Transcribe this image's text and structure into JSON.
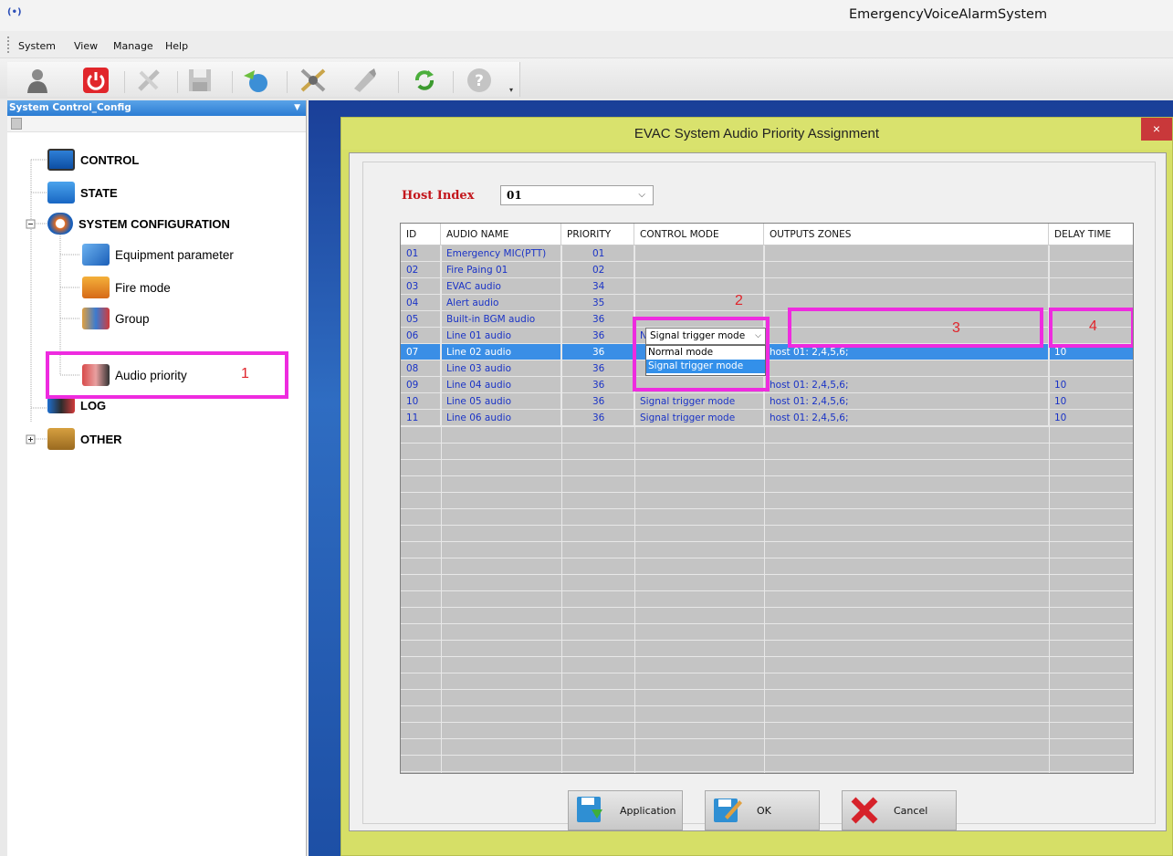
{
  "window": {
    "title": "EmergencyVoiceAlarmSystem",
    "icon": "broadcast-icon"
  },
  "menu": [
    "System",
    "View",
    "Manage",
    "Help"
  ],
  "toolbar": {
    "buttons": [
      "user-icon",
      "power-icon",
      "tools-icon",
      "save-icon",
      "globe-icon",
      "settings-icon",
      "brush-icon",
      "refresh-icon",
      "help-icon"
    ]
  },
  "panel": {
    "title": "System Control_Config",
    "tree": [
      {
        "label": "CONTROL",
        "icon": "monitor-icon"
      },
      {
        "label": "STATE",
        "icon": "screen-icon"
      },
      {
        "label": "SYSTEM CONFIGURATION",
        "icon": "gear-icon"
      },
      {
        "label": "Equipment parameter",
        "icon": "equipment-icon"
      },
      {
        "label": "Fire mode",
        "icon": "fire-icon"
      },
      {
        "label": "Group",
        "icon": "group-icon"
      },
      {
        "label": "Audio priority",
        "icon": "users-icon"
      },
      {
        "label": "LOG",
        "icon": "log-icon"
      },
      {
        "label": "OTHER",
        "icon": "toolbox-icon"
      }
    ],
    "annotation": "1"
  },
  "dialog": {
    "title": "EVAC System Audio Priority Assignment",
    "close": "×",
    "host_label": "Host Index",
    "host_value": "01",
    "columns": [
      "ID",
      "AUDIO NAME",
      "PRIORITY",
      "CONTROL MODE",
      "OUTPUTS ZONES",
      "DELAY TIME"
    ],
    "rows": [
      {
        "id": "01",
        "name": "Emergency MIC(PTT)",
        "priority": "01",
        "mode": "",
        "zones": "",
        "delay": ""
      },
      {
        "id": "02",
        "name": "Fire Paing 01",
        "priority": "02",
        "mode": "",
        "zones": "",
        "delay": ""
      },
      {
        "id": "03",
        "name": "EVAC audio",
        "priority": "34",
        "mode": "",
        "zones": "",
        "delay": ""
      },
      {
        "id": "04",
        "name": "Alert audio",
        "priority": "35",
        "mode": "",
        "zones": "",
        "delay": ""
      },
      {
        "id": "05",
        "name": "Built-in BGM audio",
        "priority": "36",
        "mode": "",
        "zones": "",
        "delay": ""
      },
      {
        "id": "06",
        "name": "Line 01 audio",
        "priority": "36",
        "mode": "Normal mode",
        "zones": "",
        "delay": ""
      },
      {
        "id": "07",
        "name": "Line 02 audio",
        "priority": "36",
        "mode": "",
        "zones": "host 01: 2,4,5,6;",
        "delay": "10"
      },
      {
        "id": "08",
        "name": "Line 03 audio",
        "priority": "36",
        "mode": "",
        "zones": "",
        "delay": ""
      },
      {
        "id": "09",
        "name": "Line 04 audio",
        "priority": "36",
        "mode": "",
        "zones": "host 01: 2,4,5,6;",
        "delay": "10"
      },
      {
        "id": "10",
        "name": "Line 05 audio",
        "priority": "36",
        "mode": "Signal trigger mode",
        "zones": "host 01: 2,4,5,6;",
        "delay": "10"
      },
      {
        "id": "11",
        "name": "Line 06 audio",
        "priority": "36",
        "mode": "Signal trigger mode",
        "zones": "host 01: 2,4,5,6;",
        "delay": "10"
      }
    ],
    "combo": {
      "value": "Signal trigger mode",
      "options": [
        "Normal mode",
        "Signal trigger mode"
      ],
      "selected_option": "Signal trigger mode"
    },
    "annotations": [
      "2",
      "3",
      "4"
    ],
    "buttons": {
      "apply": "Application",
      "ok": "OK",
      "cancel": "Cancel"
    }
  }
}
